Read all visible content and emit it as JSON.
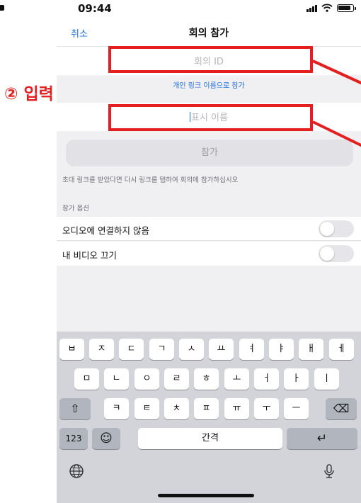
{
  "status_bar": {
    "time": "09:44"
  },
  "nav": {
    "cancel_label": "취소",
    "title": "회의 참가"
  },
  "form": {
    "meeting_id_placeholder": "회의 ID",
    "personal_link_label": "개인 링크 이름으로 참가",
    "display_name_placeholder": "표시 이름",
    "join_button_label": "참가",
    "invite_note": "초대 링크를 받았다면 다시 링크를 탭하여 회의에 참가하십시오"
  },
  "options": {
    "heading": "참가 옵션",
    "items": [
      {
        "label": "오디오에 연결하지 않음",
        "enabled": false
      },
      {
        "label": "내 비디오 끄기",
        "enabled": false
      }
    ]
  },
  "keyboard": {
    "row1": [
      "ㅂ",
      "ㅈ",
      "ㄷ",
      "ㄱ",
      "ㅅ",
      "ㅛ",
      "ㅕ",
      "ㅑ",
      "ㅐ",
      "ㅔ"
    ],
    "row2": [
      "ㅁ",
      "ㄴ",
      "ㅇ",
      "ㄹ",
      "ㅎ",
      "ㅗ",
      "ㅓ",
      "ㅏ",
      "ㅣ"
    ],
    "row3": [
      "ㅋ",
      "ㅌ",
      "ㅊ",
      "ㅍ",
      "ㅠ",
      "ㅜ",
      "ㅡ"
    ],
    "shift": "⇧",
    "backspace": "⌫",
    "numbers_label": "123",
    "emoji": "☺",
    "space_label": "간격",
    "return": "↵",
    "globe": "globe-icon",
    "mic": "mic-icon"
  },
  "annotation": {
    "label": "② 입력",
    "color": "#e41f1f"
  },
  "colors": {
    "accent": "#1d6fe0",
    "background": "#f0f0f3",
    "keyboard": "#d2d4d9"
  }
}
